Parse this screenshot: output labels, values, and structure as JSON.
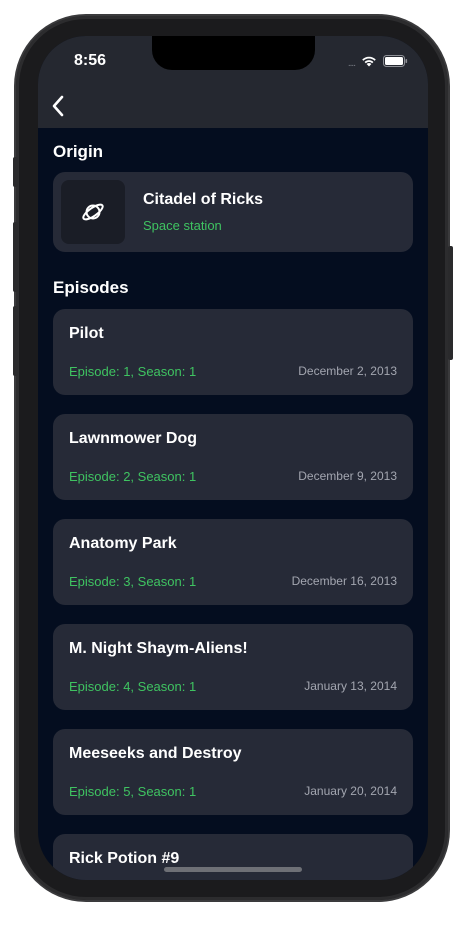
{
  "status_bar": {
    "time": "8:56",
    "signal": "....",
    "wifi_icon": "wifi-icon",
    "battery_icon": "battery-icon"
  },
  "nav": {
    "back_icon": "chevron-left-icon"
  },
  "origin": {
    "section_title": "Origin",
    "name": "Citadel of Ricks",
    "type": "Space station",
    "icon": "planet-icon"
  },
  "episodes": {
    "section_title": "Episodes",
    "items": [
      {
        "name": "Pilot",
        "code": "Episode: 1, Season: 1",
        "air_date": "December 2, 2013"
      },
      {
        "name": "Lawnmower Dog",
        "code": "Episode: 2, Season: 1",
        "air_date": "December 9, 2013"
      },
      {
        "name": "Anatomy Park",
        "code": "Episode: 3, Season: 1",
        "air_date": "December 16, 2013"
      },
      {
        "name": "M. Night Shaym-Aliens!",
        "code": "Episode: 4, Season: 1",
        "air_date": "January 13, 2014"
      },
      {
        "name": "Meeseeks and Destroy",
        "code": "Episode: 5, Season: 1",
        "air_date": "January 20, 2014"
      },
      {
        "name": "Rick Potion #9",
        "code": "",
        "air_date": ""
      }
    ]
  },
  "colors": {
    "background": "#040d1f",
    "card": "#262a37",
    "accent_green": "#3fc361",
    "header": "#252830"
  }
}
